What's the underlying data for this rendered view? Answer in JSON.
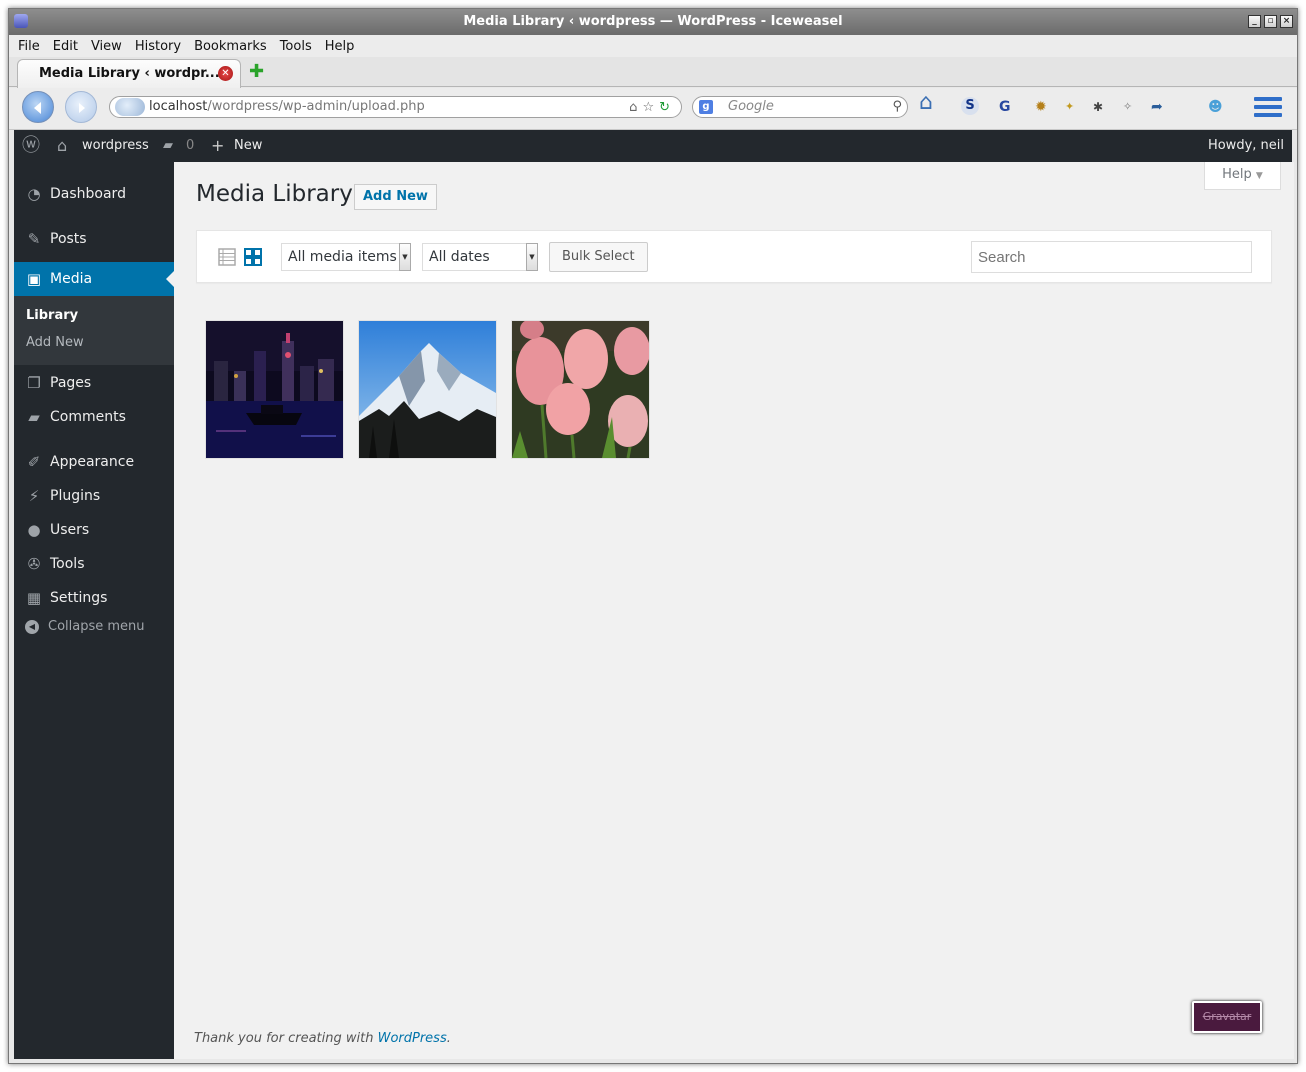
{
  "window": {
    "title": "Media Library ‹ wordpress — WordPress - Iceweasel"
  },
  "menubar": {
    "items": [
      "File",
      "Edit",
      "View",
      "History",
      "Bookmarks",
      "Tools",
      "Help"
    ]
  },
  "tabs": [
    {
      "label": "Media Library ‹ wordpr..."
    }
  ],
  "navbar": {
    "url_host": "localhost",
    "url_path": "/wordpress/wp-admin/upload.php",
    "search_placeholder": "Google"
  },
  "adminbar": {
    "site_name": "wordpress",
    "comments_count": "0",
    "new_label": "New",
    "howdy": "Howdy, neil"
  },
  "sidebar": {
    "items": [
      {
        "label": "Dashboard",
        "icon": "dashboard-icon"
      },
      {
        "label": "Posts",
        "icon": "pin-icon"
      },
      {
        "label": "Media",
        "icon": "media-icon"
      },
      {
        "label": "Pages",
        "icon": "pages-icon"
      },
      {
        "label": "Comments",
        "icon": "comments-icon"
      },
      {
        "label": "Appearance",
        "icon": "brush-icon"
      },
      {
        "label": "Plugins",
        "icon": "plug-icon"
      },
      {
        "label": "Users",
        "icon": "user-icon"
      },
      {
        "label": "Tools",
        "icon": "wrench-icon"
      },
      {
        "label": "Settings",
        "icon": "settings-icon"
      }
    ],
    "submenu": [
      "Library",
      "Add New"
    ],
    "collapse": "Collapse menu"
  },
  "main": {
    "help_tab": "Help",
    "title": "Media Library",
    "add_new": "Add New",
    "filter_type": "All media items",
    "filter_date": "All dates",
    "bulk_select": "Bulk Select",
    "search_placeholder": "Search",
    "media_items": [
      {
        "alt": "night city skyline"
      },
      {
        "alt": "snowy mountain"
      },
      {
        "alt": "pink tulips"
      }
    ]
  },
  "footer": {
    "prefix": "Thank you for creating with",
    "link": "WordPress",
    "suffix": "."
  },
  "gravatar_button": "Gravatar",
  "colors": {
    "accent": "#0073aa",
    "adminbar": "#23282d",
    "content_bg": "#f1f1f1"
  }
}
